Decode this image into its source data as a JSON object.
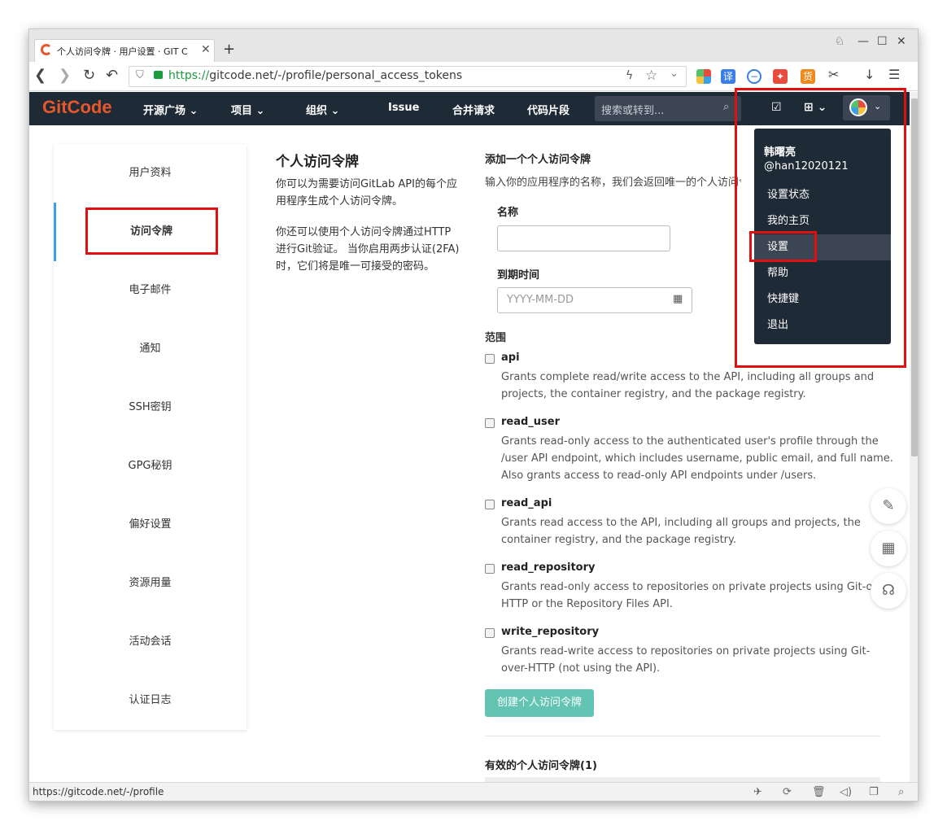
{
  "browser": {
    "tab_title": "个人访问令牌 · 用户设置 · GIT C",
    "new_tab": "+",
    "url_scheme": "https://",
    "url_host": "gitcode.net",
    "url_path": "/-/profile/personal_access_tokens",
    "status_url": "https://gitcode.net/-/profile",
    "ext_translate": "译",
    "ext_coupon": "货"
  },
  "header": {
    "logo": "GitCode",
    "nav": [
      "开源广场",
      "项目",
      "组织",
      "Issue",
      "合并请求",
      "代码片段"
    ],
    "search_placeholder": "搜索或转到..."
  },
  "sidebar": {
    "items": [
      "用户资料",
      "访问令牌",
      "电子邮件",
      "通知",
      "SSH密钥",
      "GPG秘钥",
      "偏好设置",
      "资源用量",
      "活动会话",
      "认证日志"
    ]
  },
  "intro": {
    "title": "个人访问令牌",
    "p1": "你可以为需要访问GitLab API的每个应用程序生成个人访问令牌。",
    "p2": "你还可以使用个人访问令牌通过HTTP进行Git验证。 当你启用两步认证(2FA)时，它们将是唯一可接受的密码。"
  },
  "form": {
    "title": "添加一个个人访问令牌",
    "desc": "输入你的应用程序的名称，我们会返回唯一的个人访问令牌。",
    "name_label": "名称",
    "name_value": "",
    "expiry_label": "到期时间",
    "expiry_placeholder": "YYYY-MM-DD",
    "scope_label": "范围",
    "scopes": [
      {
        "name": "api",
        "desc": "Grants complete read/write access to the API, including all groups and projects, the container registry, and the package registry."
      },
      {
        "name": "read_user",
        "desc": "Grants read-only access to the authenticated user's profile through the /user API endpoint, which includes username, public email, and full name. Also grants access to read-only API endpoints under /users."
      },
      {
        "name": "read_api",
        "desc": "Grants read access to the API, including all groups and projects, the container registry, and the package registry."
      },
      {
        "name": "read_repository",
        "desc": "Grants read-only access to repositories on private projects using Git-over-HTTP or the Repository Files API."
      },
      {
        "name": "write_repository",
        "desc": "Grants read-write access to repositories on private projects using Git-over-HTTP (not using the API)."
      }
    ],
    "submit": "创建个人访问令牌",
    "active_title": "有效的个人访问令牌(1)"
  },
  "dropdown": {
    "name": "韩曙亮",
    "username": "@han12020121",
    "items": [
      "设置状态",
      "我的主页",
      "设置",
      "帮助",
      "快捷键",
      "退出"
    ]
  },
  "colors": {
    "header_bg": "#1f2a37",
    "accent": "#3aa0e8",
    "brand": "#e8572c",
    "button": "#63c4b3",
    "annotation": "#e01010"
  }
}
